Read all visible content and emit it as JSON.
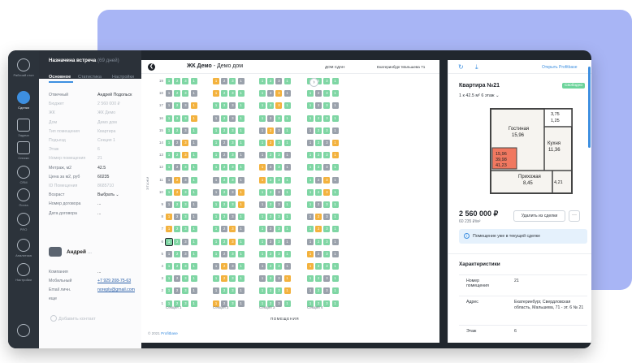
{
  "colors": {
    "accent": "#3d8fe0",
    "free": "#7fd6a4",
    "sold": "#9aa1ab",
    "reserved": "#f3b23e",
    "status_free": "#6dd49b",
    "background_blob": "#a8b5f5"
  },
  "nav": {
    "items": [
      {
        "label": "Рабочий стол",
        "icon": "desktop-icon"
      },
      {
        "label": "Сделки",
        "icon": "deals-icon"
      },
      {
        "label": "Задачи",
        "icon": "tasks-icon"
      },
      {
        "label": "Списки",
        "icon": "lists-icon"
      },
      {
        "label": "CRM",
        "icon": "crm-icon"
      },
      {
        "label": "Почта",
        "icon": "mail-icon"
      },
      {
        "label": "PRO",
        "icon": "pro-icon"
      },
      {
        "label": "Аналитика",
        "icon": "analytics-icon"
      },
      {
        "label": "Настройки",
        "icon": "settings-icon"
      }
    ]
  },
  "deal": {
    "title": "Назначена встреча",
    "title_suffix": "(69 дней)",
    "tabs": [
      "Основное",
      "Статистика",
      "Настройки"
    ],
    "fields": [
      {
        "k": "Отвечный",
        "v": "Андрей Подольск"
      },
      {
        "k": "Бюджет",
        "v": "2 560 000 ₽",
        "dim": true
      },
      {
        "k": "ЖК",
        "v": "ЖК Демо",
        "dim": true
      },
      {
        "k": "Дом",
        "v": "Демо дом",
        "dim": true
      },
      {
        "k": "Тип помещения",
        "v": "Квартира",
        "dim": true
      },
      {
        "k": "Подъезд",
        "v": "Секция 1",
        "dim": true
      },
      {
        "k": "Этаж",
        "v": "6",
        "dim": true
      },
      {
        "k": "Номер помещения",
        "v": "21",
        "dim": true
      },
      {
        "k": "Метраж, м2",
        "v": "42.5"
      },
      {
        "k": "Цена за м2, руб",
        "v": "60235"
      },
      {
        "k": "ID Помещения",
        "v": "8685710",
        "dim": true
      },
      {
        "k": "Возраст",
        "v": "Выбрать ⌄"
      },
      {
        "k": "Номер договора",
        "v": "..."
      },
      {
        "k": "Дата договора",
        "v": "..."
      }
    ],
    "contact": {
      "name": "Андрей",
      "dots": "...",
      "fields": [
        {
          "k": "Компания",
          "v": "..."
        },
        {
          "k": "Мобильный",
          "v": "+7 929 208-75-63",
          "link": true
        },
        {
          "k": "Email личн.",
          "v": "noreply@gmail.com",
          "link": true
        },
        {
          "k": "еще",
          "v": ""
        }
      ]
    },
    "add_contact": "Добавить контакт"
  },
  "chess": {
    "back": "❮",
    "project": "ЖК Демо",
    "house": "- Демо дом",
    "status": "ДОМ СДАН",
    "address": "Екатеринбург Мальшева 71",
    "floors_label": "ЭТАЖИ",
    "rooms_label": "ПОМЕЩЕНИЯ",
    "sections": [
      "Секция 1",
      "Секция 2",
      "Секция 3",
      "Секция 4"
    ],
    "floors": [
      "19",
      "18",
      "17",
      "16",
      "15",
      "14",
      "13",
      "12",
      "11",
      "10",
      "9",
      "8",
      "7",
      "6",
      "5",
      "4",
      "3",
      "2",
      "1"
    ],
    "copyright": "© 2021",
    "copyright_link": "Profitbase"
  },
  "detail": {
    "open_label": "Открыть Profitbase",
    "title": "Квартира №21",
    "status": "Свободно",
    "meta": "1 к     42.5 м²     6 этаж    ⌄",
    "plan": {
      "living": "Гостиная",
      "living_area": "15,96",
      "kitchen": "Кухня",
      "kitchen_area": "11,36",
      "hall": "Прихожая",
      "hall_area": "8,45",
      "balcony": "3,75",
      "balcony2": "1,25",
      "small": "4,21",
      "c1": "15,96",
      "c2": "39,98",
      "c3": "41,23"
    },
    "price": "2 560 000 ₽",
    "price_m2": "60 235 ₽/м²",
    "remove_label": "Удалить из сделки",
    "more_label": "···",
    "notice": "Помещение уже в текущей сделке",
    "chars_title": "Характеристики",
    "chars": [
      {
        "k": "Номер помещения",
        "v": "21"
      },
      {
        "k": "Адрес",
        "v": "Екатеринбург, Свердловская область, Мальшева, 71 - эт. 6 № 21"
      },
      {
        "k": "Этаж",
        "v": "6"
      }
    ]
  }
}
